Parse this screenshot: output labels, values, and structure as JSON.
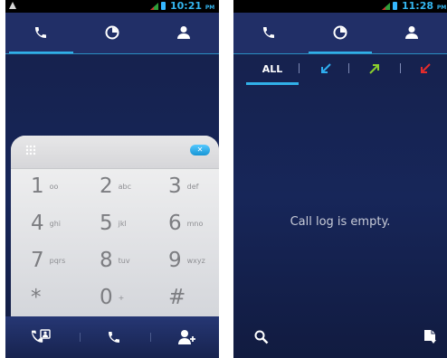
{
  "left_screen": {
    "status_bar": {
      "time": "10:21",
      "ampm": "PM"
    },
    "tabs": [
      {
        "icon": "phone-icon",
        "active": true
      },
      {
        "icon": "clock-icon",
        "active": false
      },
      {
        "icon": "person-icon",
        "active": false
      }
    ],
    "dialpad": {
      "keys": [
        {
          "digit": "1",
          "letters": "oo"
        },
        {
          "digit": "2",
          "letters": "abc"
        },
        {
          "digit": "3",
          "letters": "def"
        },
        {
          "digit": "4",
          "letters": "ghi"
        },
        {
          "digit": "5",
          "letters": "jkl"
        },
        {
          "digit": "6",
          "letters": "mno"
        },
        {
          "digit": "7",
          "letters": "pqrs"
        },
        {
          "digit": "8",
          "letters": "tuv"
        },
        {
          "digit": "9",
          "letters": "wxyz"
        },
        {
          "digit": "*",
          "letters": ""
        },
        {
          "digit": "0",
          "letters": "+"
        },
        {
          "digit": "#",
          "letters": ""
        }
      ]
    },
    "bottom_bar": [
      "contacts-call-icon",
      "phone-icon",
      "add-person-icon"
    ]
  },
  "right_screen": {
    "status_bar": {
      "time": "11:28",
      "ampm": "PM"
    },
    "tabs": [
      {
        "icon": "phone-icon",
        "active": false
      },
      {
        "icon": "clock-icon",
        "active": true
      },
      {
        "icon": "person-icon",
        "active": false
      }
    ],
    "filters": {
      "all_label": "ALL",
      "incoming_color": "#2eaef0",
      "outgoing_color": "#8ccf2c",
      "missed_color": "#e42b2b"
    },
    "empty_message": "Call log is empty.",
    "bottom_bar": [
      "search-icon",
      "clear-log-icon"
    ]
  },
  "colors": {
    "accent": "#31b0e8",
    "background": "#172659",
    "tab_bar": "#212f67"
  }
}
